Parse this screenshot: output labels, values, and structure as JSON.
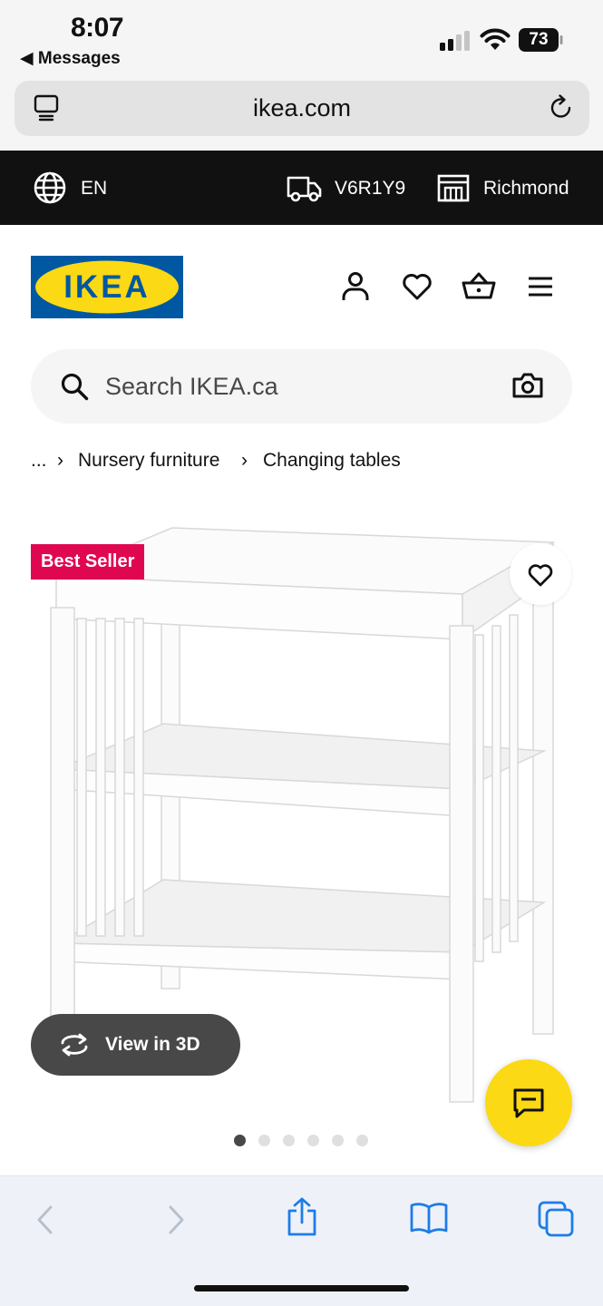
{
  "status_bar": {
    "time": "8:07",
    "back_app": "◀ Messages",
    "battery": "73"
  },
  "browser": {
    "url": "ikea.com"
  },
  "utility_bar": {
    "language": "EN",
    "postal_code": "V6R1Y9",
    "store": "Richmond"
  },
  "header": {
    "logo_text": "IKEA"
  },
  "search": {
    "placeholder": "Search IKEA.ca"
  },
  "breadcrumb": {
    "ellipsis": "...",
    "separator": "›",
    "items": [
      "Nursery furniture",
      "Changing tables"
    ]
  },
  "product": {
    "badge": "Best Seller",
    "view_3d_label": "View in 3D"
  },
  "carousel": {
    "total": 6,
    "active_index": 0
  },
  "colors": {
    "ikea_blue": "#0058a3",
    "ikea_yellow": "#fbd914",
    "badge_red": "#e00751",
    "safari_blue": "#1e7ce8"
  },
  "icons": {
    "language": "globe-icon",
    "delivery": "truck-icon",
    "store": "store-icon",
    "account": "user-icon",
    "wishlist": "heart-icon",
    "cart": "basket-icon",
    "menu": "hamburger-icon",
    "search": "search-icon",
    "visual_search": "camera-icon",
    "chat": "chat-icon",
    "nav_back": "chevron-left-icon",
    "nav_forward": "chevron-right-icon",
    "share": "share-icon",
    "bookmarks": "book-icon",
    "tabs": "tabs-icon",
    "tab_overview": "tab-overview-icon",
    "reload": "reload-icon"
  }
}
